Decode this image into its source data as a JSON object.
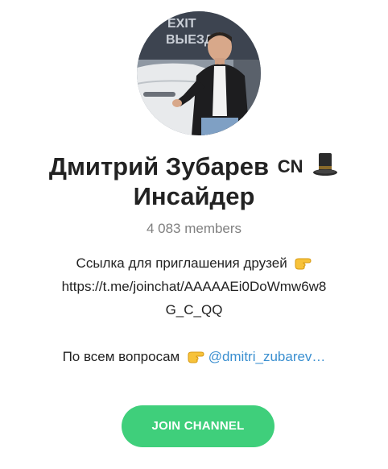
{
  "channel": {
    "title_line1": "Дмитрий Зубарев",
    "badge": "CN",
    "title_line2": "Инсайдер",
    "members": "4 083 members"
  },
  "avatar": {
    "sign_line1": "EXIT",
    "sign_line2": "ВЫЕЗД"
  },
  "description": {
    "line1": "Ссылка для приглашения друзей",
    "line2": "https://t.me/joinchat/AAAAAEi0DoWmw6w8",
    "line3": "G_C_QQ",
    "line4_text": "По всем вопросам",
    "line4_mention": "@dmitri_zubarev…"
  },
  "icons": {
    "hat": "top-hat-icon",
    "point": "backhand-index-pointing-right-icon"
  },
  "actions": {
    "join_label": "JOIN CHANNEL"
  },
  "colors": {
    "button": "#3fcf7b",
    "link": "#3a8fd0",
    "muted": "#808080"
  }
}
